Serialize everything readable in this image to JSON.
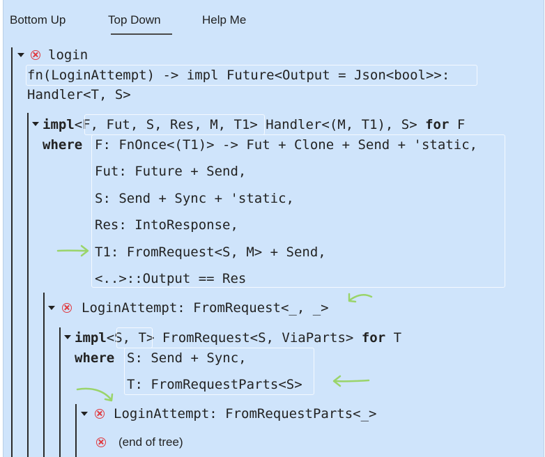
{
  "tabs": [
    {
      "label": "Bottom Up"
    },
    {
      "label": "Top Down"
    },
    {
      "label": "Help Me"
    }
  ],
  "tree": {
    "root": {
      "label": "login",
      "signature_line1": "fn(LoginAttempt) -> impl Future<Output = Json<bool>>:",
      "signature_line2": "Handler<T, S>"
    },
    "impl_handler": {
      "impl_kw": "impl",
      "head_rest": "<F, Fut, S, Res, M, T1> Handler<(M, T1), S> ",
      "for_kw": "for",
      "head_tail": " F",
      "where_kw": "where",
      "clauses": [
        "F: FnOnce<(T1)> -> Fut + Clone + Send + 'static,",
        "Fut: Future + Send,",
        "S: Send + Sync + 'static,",
        "Res: IntoResponse,",
        "T1: FromRequest<S, M> + Send,",
        "<..>::Output == Res"
      ]
    },
    "from_request": {
      "label": "LoginAttempt: FromRequest<_, _>"
    },
    "impl_from_request": {
      "impl_kw": "impl",
      "head_rest": "<S, T> FromRequest<S, ViaParts> ",
      "for_kw": "for",
      "head_tail": " T",
      "where_kw": "where",
      "clauses": [
        "S: Send + Sync,",
        "T: FromRequestParts<S>"
      ]
    },
    "from_request_parts": {
      "label": "LoginAttempt: FromRequestParts<_>"
    },
    "end": {
      "label": "(end of tree)"
    }
  },
  "colors": {
    "panel_bg": "#cfe4fb",
    "error_icon": "#e0393e",
    "annotation_arrow": "#9ad46a",
    "text": "#222222"
  },
  "icons": [
    "error-circle-x-icon",
    "collapse-triangle-icon",
    "annotation-arrow"
  ]
}
